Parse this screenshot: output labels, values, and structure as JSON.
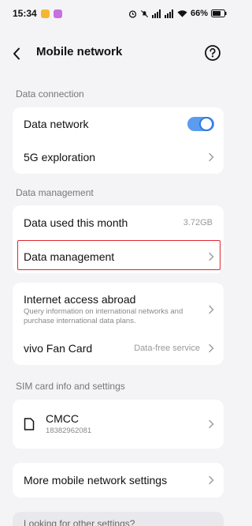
{
  "status_bar": {
    "time": "15:34",
    "battery": "66%",
    "badge_colors": [
      "#f5b731",
      "#c770e0"
    ]
  },
  "header": {
    "title": "Mobile network",
    "back_icon": "arrow-left-icon",
    "help_icon": "help-circle-icon"
  },
  "sections": {
    "data_connection": "Data connection",
    "data_management": "Data management",
    "sim": "SIM card info and settings"
  },
  "data_connection": {
    "data_network_label": "Data network",
    "data_network_on": true,
    "exploration_label": "5G exploration"
  },
  "data_management": {
    "used_label": "Data used this month",
    "used_value": "3.72GB",
    "management_label": "Data management"
  },
  "abroad": {
    "title": "Internet access abroad",
    "subtitle": "Query information on international networks and purchase international data plans.",
    "fan_card_label": "vivo Fan Card",
    "fan_card_value": "Data-free service"
  },
  "sim": {
    "carrier": "CMCC",
    "number": "18382962081"
  },
  "more": {
    "label": "More mobile network settings"
  },
  "footer": {
    "text": "Looking for other settings?"
  },
  "colors": {
    "accent": "#2f7be0",
    "highlight": "#e0262e"
  }
}
